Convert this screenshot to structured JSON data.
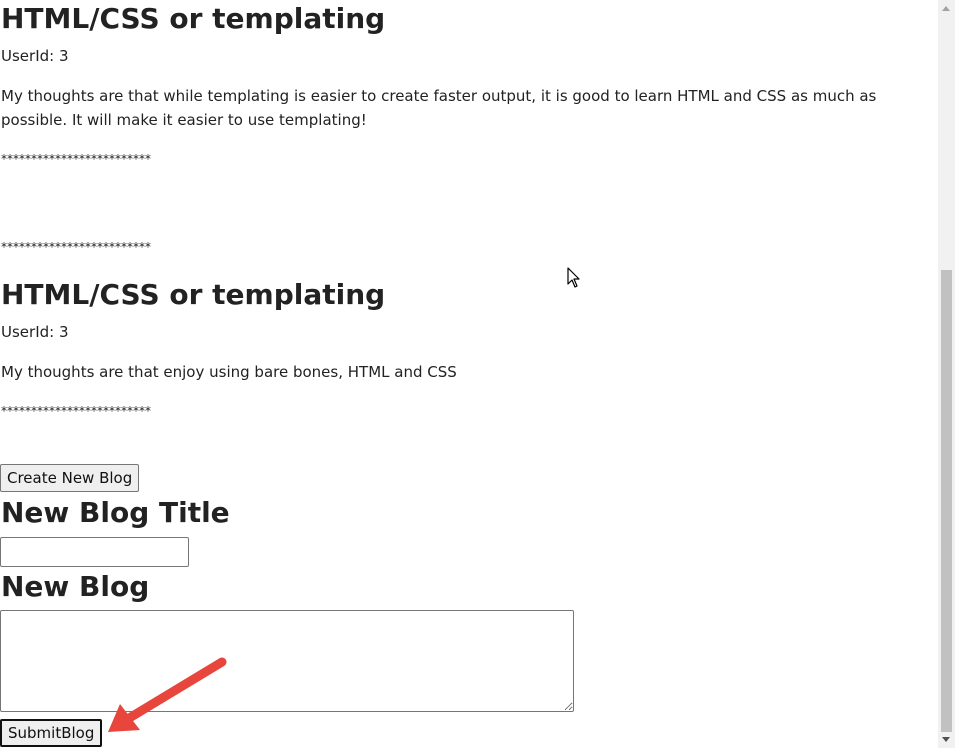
{
  "posts": [
    {
      "title": "HTML/CSS or templating",
      "user_id_text": "UserId: 3",
      "body": "My thoughts are that while templating is easier to create faster output, it is good to learn HTML and CSS as much as possible. It will make it easier to use templating!",
      "separator": "*************************"
    },
    {
      "separator_top": "*************************",
      "title": "HTML/CSS or templating",
      "user_id_text": "UserId: 3",
      "body": "My thoughts are that enjoy using bare bones, HTML and CSS",
      "separator": "*************************"
    }
  ],
  "form": {
    "create_button_label": "Create New Blog",
    "title_heading": "New Blog Title",
    "title_input_value": "",
    "blog_heading": "New Blog",
    "blog_textarea_value": "",
    "submit_button_label": "SubmitBlog"
  },
  "colors": {
    "annotation_arrow": "#e8453c",
    "scrollbar_thumb": "#c1c1c1"
  },
  "icons": {
    "cursor": "mouse-pointer-icon",
    "annotation": "red-arrow-annotation"
  }
}
